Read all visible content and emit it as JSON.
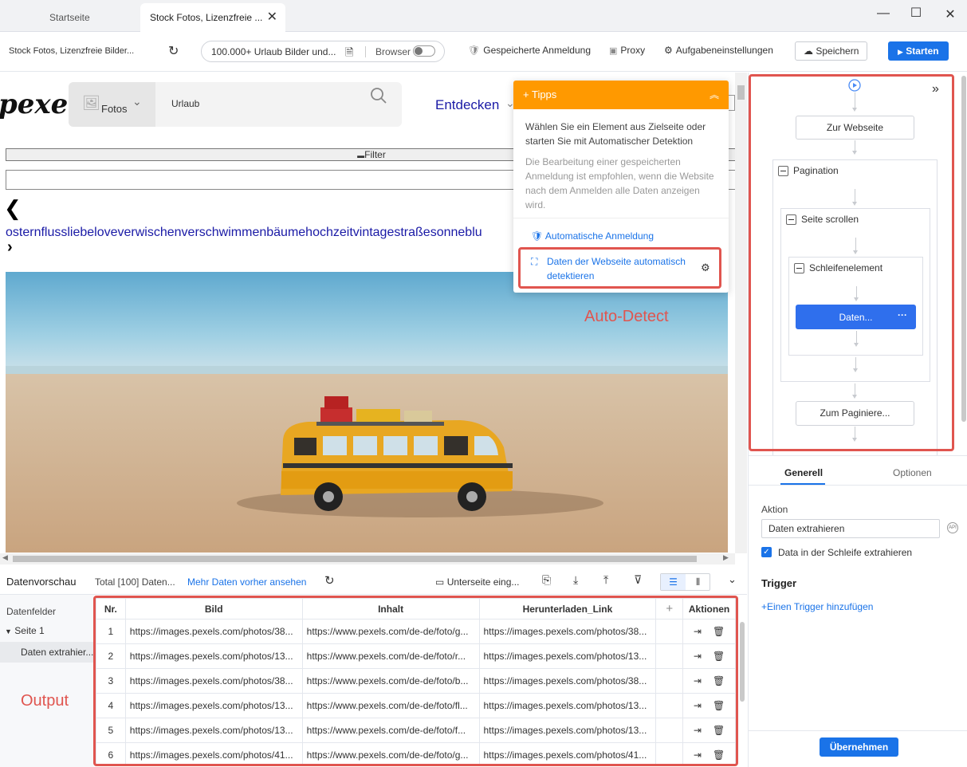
{
  "window": {
    "tabs": [
      {
        "label": "Startseite"
      },
      {
        "label": "Stock Fotos, Lizenzfreie ..."
      }
    ]
  },
  "toolbar": {
    "page_title": "Stock Fotos, Lizenzfreie Bilder...",
    "url_value": "100.000+ Urlaub Bilder und...",
    "browser_label": "Browser",
    "saved_login": "Gespeicherte Anmeldung",
    "proxy": "Proxy",
    "task_settings": "Aufgabeneinstellungen",
    "save": "Speichern",
    "start": "Starten"
  },
  "webpage": {
    "logo": "pexels",
    "search_type": "Fotos",
    "search_value": "Urlaub",
    "nav_explore": "Entdecken",
    "filter_label": "Filter",
    "tags_text": "osternflussliebeloveverwischenverschwimmenbäumehochzeitvintagestraßesonneblu"
  },
  "tipps": {
    "title": "Tipps",
    "text1": "Wählen Sie ein Element aus Zielseite oder starten Sie mit Automatischer Detektion",
    "text2": "Die Bearbeitung einer gespeicherten Anmeldung ist empfohlen, wenn die Website nach dem Anmelden alle Daten anzeigen wird.",
    "auto_login": "Automatische Anmeldung",
    "auto_detect": "Daten der Webseite automatisch detektieren"
  },
  "annotations": {
    "auto_detect": "Auto-Detect",
    "output": "Output"
  },
  "workflow": {
    "goto_page": "Zur Webseite",
    "pagination": "Pagination",
    "scroll_page": "Seite scrollen",
    "loop_element": "Schleifenelement",
    "data_node": "Daten...",
    "goto_pagination": "Zum Paginiere..."
  },
  "settings": {
    "tab_general": "Generell",
    "tab_options": "Optionen",
    "action_label": "Aktion",
    "action_value": "Daten extrahieren",
    "loop_checkbox": "Data in der Schleife extrahieren",
    "trigger_title": "Trigger",
    "add_trigger": "+Einen Trigger hinzufügen",
    "apply": "Übernehmen"
  },
  "preview": {
    "title": "Datenvorschau",
    "total": "Total [100] Daten...",
    "more_data": "Mehr Daten vorher ansehen",
    "subpage": "Unterseite eing...",
    "fields_label": "Datenfelder",
    "page1": "Seite 1",
    "extract_item": "Daten extrahier...",
    "columns": [
      "Nr.",
      "Bild",
      "Inhalt",
      "Herunterladen_Link",
      "+",
      "Aktionen"
    ],
    "rows": [
      [
        "1",
        "https://images.pexels.com/photos/38...",
        "https://www.pexels.com/de-de/foto/g...",
        "https://images.pexels.com/photos/38..."
      ],
      [
        "2",
        "https://images.pexels.com/photos/13...",
        "https://www.pexels.com/de-de/foto/r...",
        "https://images.pexels.com/photos/13..."
      ],
      [
        "3",
        "https://images.pexels.com/photos/38...",
        "https://www.pexels.com/de-de/foto/b...",
        "https://images.pexels.com/photos/38..."
      ],
      [
        "4",
        "https://images.pexels.com/photos/13...",
        "https://www.pexels.com/de-de/foto/fl...",
        "https://images.pexels.com/photos/13..."
      ],
      [
        "5",
        "https://images.pexels.com/photos/13...",
        "https://www.pexels.com/de-de/foto/f...",
        "https://images.pexels.com/photos/13..."
      ],
      [
        "6",
        "https://images.pexels.com/photos/41...",
        "https://www.pexels.com/de-de/foto/g...",
        "https://images.pexels.com/photos/41..."
      ]
    ]
  },
  "colors": {
    "accent": "#1a73e8",
    "tipps_header": "#ff9900",
    "highlight_red": "#e0554f"
  }
}
